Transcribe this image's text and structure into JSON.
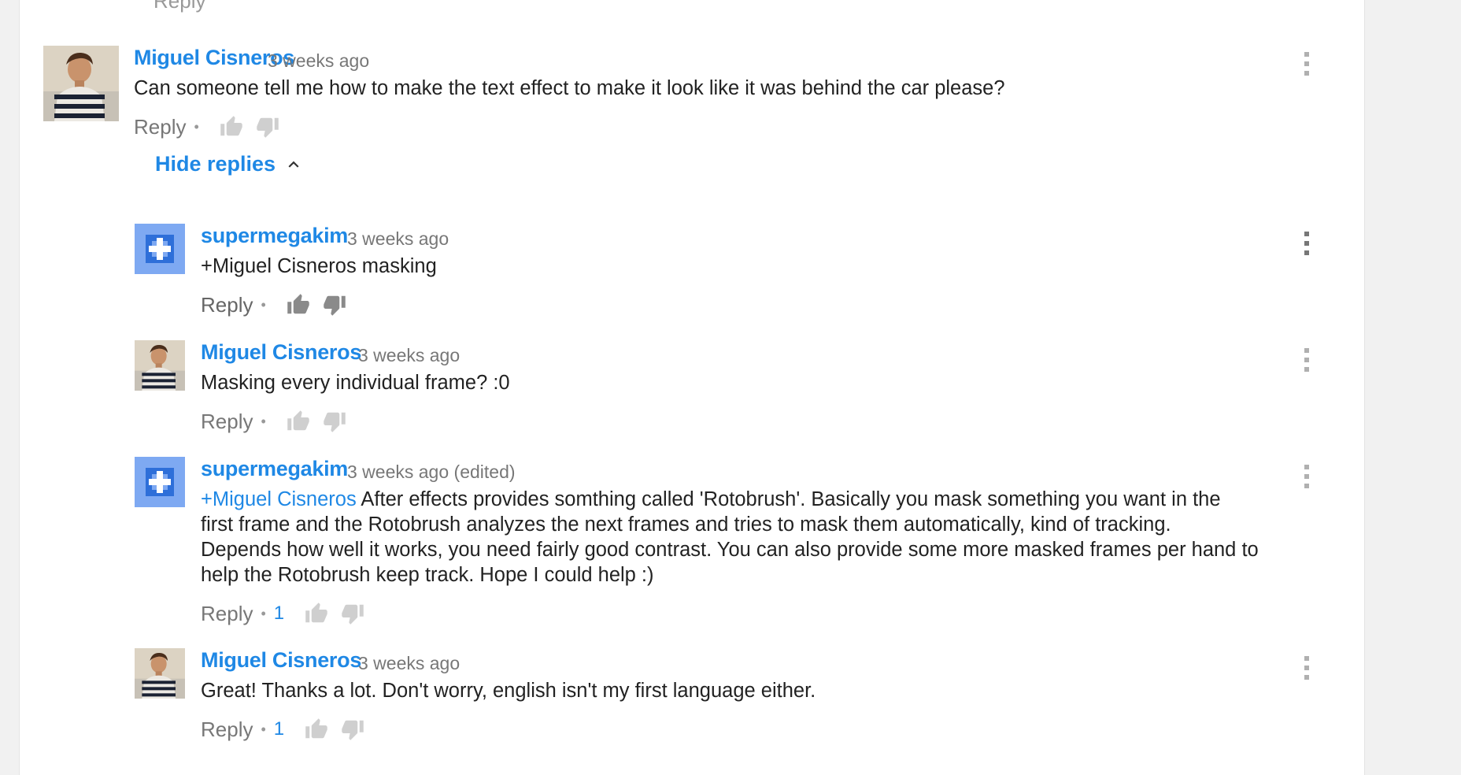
{
  "partial_top": {
    "reply_label": "Reply"
  },
  "thread": {
    "hide_replies_label": "Hide replies"
  },
  "comments": [
    {
      "author": "Miguel Cisneros",
      "time": "3 weeks ago",
      "text": "Can someone tell me how to make the text effect to make it look like it was behind the car please?",
      "reply_label": "Reply",
      "avatar": "profile-photo"
    },
    {
      "author": "supermegakim",
      "time": "3 weeks ago",
      "text": "+Miguel Cisneros masking",
      "reply_label": "Reply",
      "avatar": "google-plus-default-avatar"
    },
    {
      "author": "Miguel Cisneros",
      "time": "3 weeks ago",
      "text": "Masking every individual frame? :0",
      "reply_label": "Reply",
      "avatar": "profile-photo"
    },
    {
      "author": "supermegakim",
      "time": "3 weeks ago (edited)",
      "mention": "+Miguel Cisneros",
      "lines": [
        " After effects provides somthing called 'Rotobrush'. Basically you mask something you want in the",
        "first frame and the Rotobrush analyzes the next frames and tries to mask them automatically, kind of tracking.",
        "Depends how well it works, you need fairly good contrast. You can also provide some more masked frames per hand to",
        "help the Rotobrush keep track. Hope I could help :)"
      ],
      "reply_label": "Reply",
      "likes": "1",
      "avatar": "google-plus-default-avatar"
    },
    {
      "author": "Miguel Cisneros",
      "time": "3 weeks ago",
      "text": "Great! Thanks a lot. Don't worry, english isn't my first language either.",
      "reply_label": "Reply",
      "likes": "1",
      "avatar": "profile-photo"
    }
  ],
  "colors": {
    "link_blue": "#1f88e5",
    "meta_gray": "#777777",
    "icon_gray": "#b0b0b0",
    "text": "#222222",
    "page_bg": "#f1f1f1",
    "card_bg": "#ffffff",
    "gplus_avatar": "#7ea9f2"
  },
  "icons": [
    "thumbs-up-icon",
    "thumbs-down-icon",
    "more-vert-icon",
    "chevron-up-icon"
  ]
}
